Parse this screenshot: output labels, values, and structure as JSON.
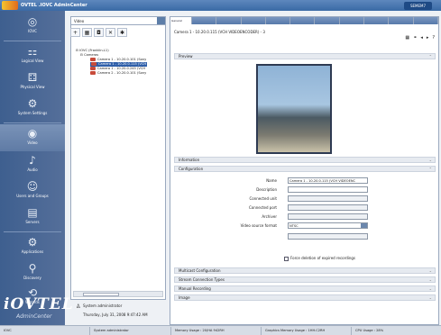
{
  "app": {
    "title": "OVTEL .IOVC AdminCenter",
    "version": "SEMEM7"
  },
  "nav": [
    {
      "label": "IOVC",
      "icon": "globe-icon",
      "glyph": "◎"
    },
    {
      "label": "Logical View",
      "icon": "logical-view-icon",
      "glyph": "⚏"
    },
    {
      "label": "Physical View",
      "icon": "physical-view-icon",
      "glyph": "⚃"
    },
    {
      "label": "System Settings",
      "icon": "settings-icon",
      "glyph": "⚙"
    },
    {
      "label": "Video",
      "icon": "video-icon",
      "glyph": "◉"
    },
    {
      "label": "Audio",
      "icon": "audio-icon",
      "glyph": "♪"
    },
    {
      "label": "Users and Groups",
      "icon": "users-icon",
      "glyph": "☺"
    },
    {
      "label": "Servers",
      "icon": "servers-icon",
      "glyph": "▤"
    },
    {
      "label": "Applications",
      "icon": "applications-icon",
      "glyph": "⚙"
    },
    {
      "label": "Discovery",
      "icon": "discovery-icon",
      "glyph": "⚲"
    },
    {
      "label": "Wizards",
      "icon": "wizards-icon",
      "glyph": "⟲"
    }
  ],
  "brand": {
    "line1": "iOVTEL",
    "line2": "AdminCenter"
  },
  "tree": {
    "selector": "Video",
    "nodes": [
      {
        "text": "IOVC (Franklin-L1)",
        "level": 0
      },
      {
        "text": "Cameras",
        "level": 1
      },
      {
        "text": "Camera 1 - 10.20.0.101 (Sony",
        "level": 2
      },
      {
        "text": "Camera 1 - 10.20.0.115 (VCH",
        "level": 2,
        "selected": true
      },
      {
        "text": "Camera 1 - 10.20.0.245 (VCH",
        "level": 2
      },
      {
        "text": "Camera 2 - 10.20.0.101 (Sony",
        "level": 2
      }
    ]
  },
  "user": {
    "name": "System administrator",
    "date": "Thursday, July 31, 2008 9:47:42 AM"
  },
  "main": {
    "tabs": [
      "General",
      "",
      "",
      "",
      "",
      "",
      "",
      "",
      "",
      "",
      ""
    ],
    "header": "Camera 1 - 10.20.0.115 (VCH VIDEOENCODER) - 3",
    "sections": {
      "preview": "Preview",
      "information": "Information",
      "configuration": "Configuration",
      "multicast": "Multicast Configuration",
      "stream": "Stream Connection Types",
      "manual": "Manual Recording",
      "image": "Image"
    },
    "hide_link": "Hide preview",
    "fields": [
      {
        "label": "Name",
        "value": "Camera 1 - 10.20.0.115 (VCH VIDEOENC"
      },
      {
        "label": "Description",
        "value": ""
      },
      {
        "label": "Connected unit",
        "value": "",
        "disabled": true
      },
      {
        "label": "Connected port",
        "value": "",
        "disabled": true
      },
      {
        "label": "Archiver",
        "value": "",
        "disabled": true
      },
      {
        "label": "Video source format",
        "value": "NTSC",
        "dropdown": true
      },
      {
        "label": "",
        "value": "",
        "disabled": true
      }
    ],
    "checkbox": "Force deletion of expired recordings"
  },
  "status": [
    "IOVC",
    "System administrator",
    "Memory Usage : 20/HA 942RH",
    "Graphics Memory Usage : 1HH.C2RH",
    "CPU Usage : 28%"
  ]
}
